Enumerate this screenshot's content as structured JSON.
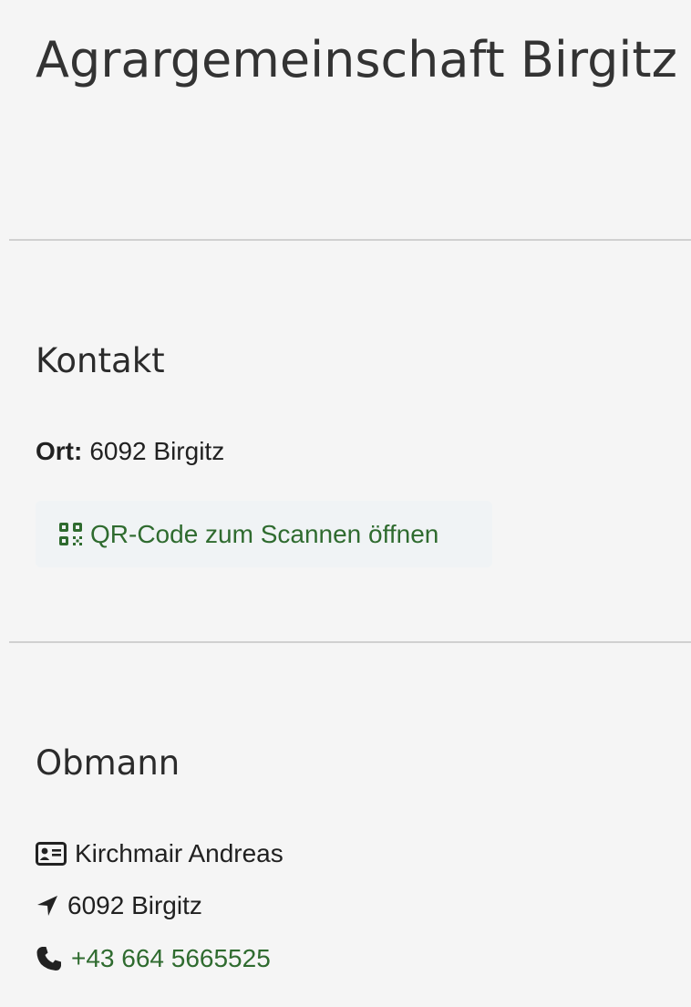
{
  "page": {
    "title": "Agrargemeinschaft Birgitz"
  },
  "contact": {
    "heading": "Kontakt",
    "ort_label": "Ort:",
    "ort_value": "6092 Birgitz",
    "qr_button_label": "QR-Code zum Scannen öffnen",
    "qr_icon": "qrcode-icon"
  },
  "obmann": {
    "heading": "Obmann",
    "name": "Kirchmair Andreas",
    "location": "6092 Birgitz",
    "phone": "+43 664 5665525",
    "icons": {
      "name": "id-card-icon",
      "location": "location-arrow-icon",
      "phone": "phone-icon"
    }
  },
  "colors": {
    "link": "#2f6b2f",
    "button_bg": "#f0f3f5",
    "divider": "#d0d0d0"
  }
}
